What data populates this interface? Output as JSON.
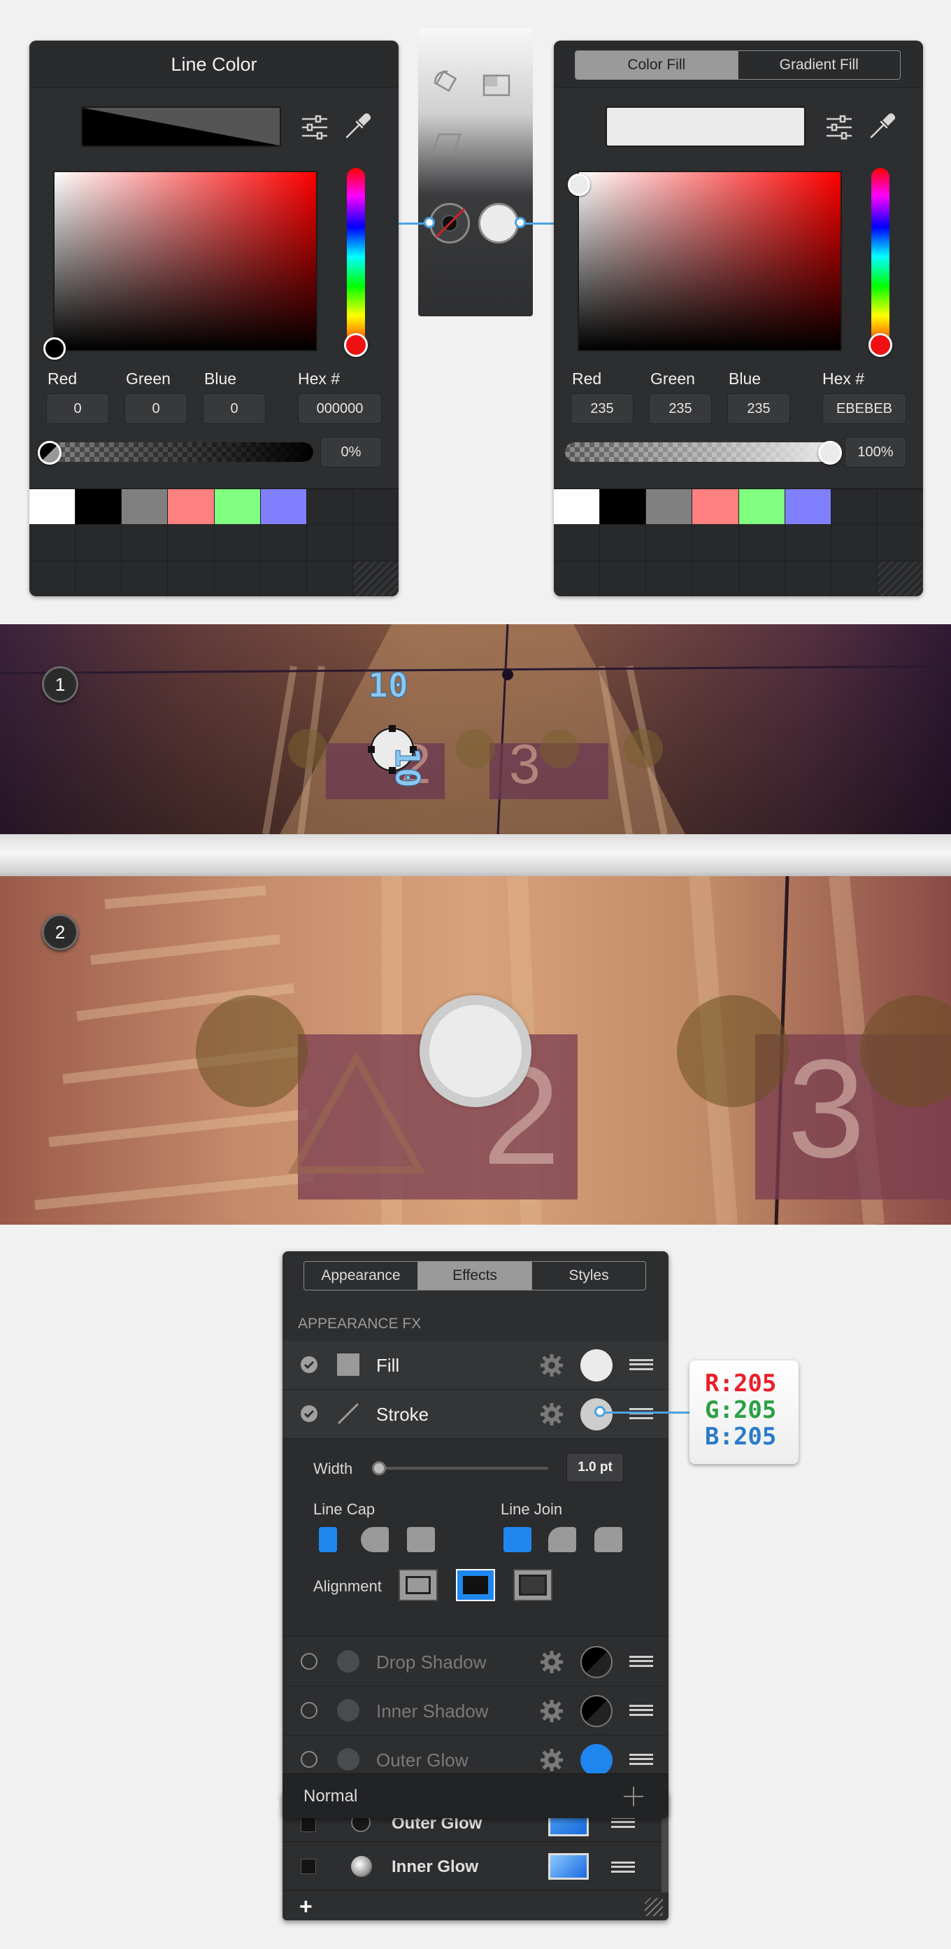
{
  "line_color_panel": {
    "title": "Line Color",
    "red_label": "Red",
    "green_label": "Green",
    "blue_label": "Blue",
    "hex_label": "Hex #",
    "red": "0",
    "green": "0",
    "blue": "0",
    "hex": "000000",
    "opacity": "0%",
    "opacity_level": 0,
    "swatches": [
      "#ffffff",
      "#000000",
      "#808080",
      "#ff8080",
      "#80ff80",
      "#8080ff"
    ]
  },
  "fill_color_panel": {
    "tab_color_fill": "Color Fill",
    "tab_gradient_fill": "Gradient Fill",
    "red_label": "Red",
    "green_label": "Green",
    "blue_label": "Blue",
    "hex_label": "Hex #",
    "red": "235",
    "green": "235",
    "blue": "235",
    "hex": "EBEBEB",
    "opacity": "100%",
    "opacity_level": 1,
    "swatches": [
      "#ffffff",
      "#000000",
      "#808080",
      "#ff8080",
      "#80ff80",
      "#8080ff"
    ]
  },
  "photo_step_1": {
    "badge": "1",
    "dim_horizontal": "10",
    "dim_vertical": "10",
    "sign_numbers": [
      "2",
      "3"
    ]
  },
  "photo_step_2": {
    "badge": "2",
    "sign_numbers": [
      "2",
      "3"
    ]
  },
  "effects_panel": {
    "tabs": [
      {
        "label": "Appearance",
        "active": false
      },
      {
        "label": "Effects",
        "active": true
      },
      {
        "label": "Styles",
        "active": false
      }
    ],
    "section_header": "APPEARANCE FX",
    "fill_label": "Fill",
    "stroke_label": "Stroke",
    "width_label": "Width",
    "width_value": "1.0 pt",
    "line_cap_label": "Line Cap",
    "line_join_label": "Line Join",
    "alignment_label": "Alignment",
    "drop_shadow_label": "Drop Shadow",
    "inner_shadow_label": "Inner Shadow",
    "outer_glow_label": "Outer Glow",
    "blend_mode": "Normal",
    "underlay_outer_glow": "Outer Glow",
    "underlay_inner_glow": "Inner Glow",
    "colors": {
      "accent": "#1f86f0",
      "fill": "#ebebeb",
      "stroke": "#cdcdcd"
    }
  },
  "color_callout": {
    "r": "R:205",
    "g": "G:205",
    "b": "B:205",
    "r_color": "#e8202a",
    "g_color": "#2aa043",
    "b_color": "#2a7bc8"
  }
}
